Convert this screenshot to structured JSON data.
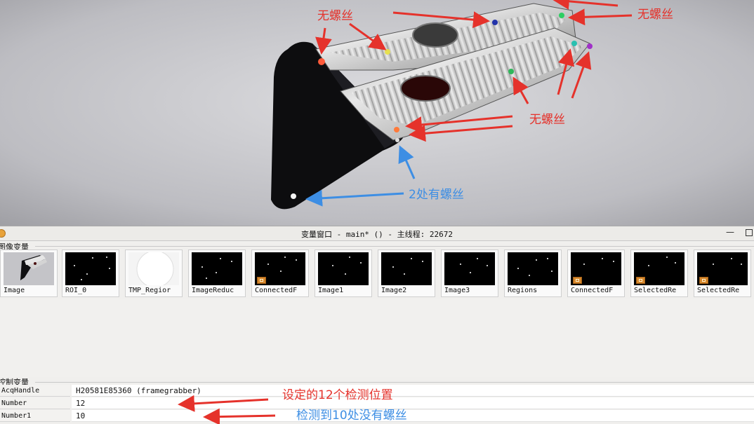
{
  "photo": {
    "annotations": {
      "top_left": "无螺丝",
      "top_right": "无螺丝",
      "middle_right": "无螺丝",
      "bottom": "2处有螺丝"
    },
    "colors": {
      "annotation_red": "#e5322b",
      "annotation_blue": "#3d8ee4"
    }
  },
  "window": {
    "title": "变量窗口 - main* () - 主线程: 22672",
    "title_icon": "halcon-icon",
    "minimize_label": "—"
  },
  "image_variables": {
    "section_label": "图像变量",
    "items": [
      {
        "label": "Image",
        "kind": "photo"
      },
      {
        "label": "ROI_0",
        "kind": "region"
      },
      {
        "label": "TMP_Regior",
        "kind": "circle"
      },
      {
        "label": "ImageReduc",
        "kind": "region"
      },
      {
        "label": "ConnectedF",
        "kind": "region-tuple"
      },
      {
        "label": "Image1",
        "kind": "region"
      },
      {
        "label": "Image2",
        "kind": "region"
      },
      {
        "label": "Image3",
        "kind": "region"
      },
      {
        "label": "Regions",
        "kind": "region"
      },
      {
        "label": "ConnectedF",
        "kind": "region-tuple"
      },
      {
        "label": "SelectedRe",
        "kind": "region-tuple"
      },
      {
        "label": "SelectedRe",
        "kind": "region-tuple"
      }
    ]
  },
  "control_variables": {
    "section_label": "控制变量",
    "rows": [
      {
        "name": "AcqHandle",
        "value": "H20581E85360 (framegrabber)"
      },
      {
        "name": "Number",
        "value": "12"
      },
      {
        "name": "Number1",
        "value": "10"
      }
    ],
    "annotations": {
      "number": "设定的12个检测位置",
      "number1": "检测到10处没有螺丝"
    }
  }
}
